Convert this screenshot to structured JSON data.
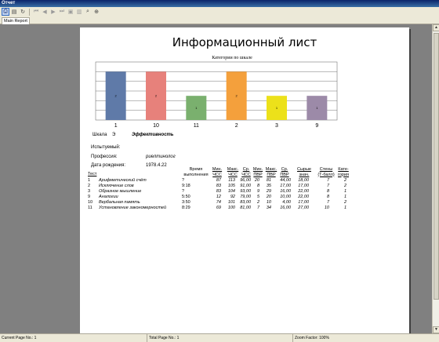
{
  "window": {
    "title": "Отчет"
  },
  "toolbar": {
    "icons": [
      "print-icon",
      "page-setup-icon",
      "refresh-icon",
      "first-page-icon",
      "prev-page-icon",
      "next-page-icon",
      "last-page-icon",
      "export-icon",
      "save-icon",
      "find-icon",
      "zoom-icon"
    ]
  },
  "tab": {
    "label": "Main Report"
  },
  "report": {
    "title": "Информационный лист",
    "scale_label": "Шкала",
    "scale_value": "Э",
    "scale_name": "Эффективность",
    "subject_label": "Испытуемый:",
    "profession_label": "Профессия:",
    "profession_value": "риелтинолог",
    "birthdate_label": "Дата рождения:",
    "birthdate_value": "1978.4.22"
  },
  "chart_data": {
    "type": "bar",
    "title": "Категории по шкале",
    "categories": [
      "1",
      "10",
      "11",
      "2",
      "3",
      "9"
    ],
    "values": [
      2,
      2,
      1,
      2,
      1,
      1
    ],
    "colors": [
      "#5f7aa8",
      "#e7817b",
      "#7ab06e",
      "#f4a03c",
      "#ece11a",
      "#9c8aa8"
    ],
    "ylim": [
      0,
      2.4
    ],
    "grid": true
  },
  "table": {
    "headers": {
      "test": "Тест",
      "time": [
        "Время",
        "выполнения"
      ],
      "min_hr": [
        "Мин.",
        "ЧСС"
      ],
      "max_hr": [
        "Макс.",
        "ЧСС"
      ],
      "avg_hr": [
        "Ср.",
        "ЧСС"
      ],
      "min_bp": [
        "Мин.",
        "ПВР"
      ],
      "max_bp": [
        "Макс.",
        "ПВР"
      ],
      "avg_bp": [
        "Ср.",
        "ПВР"
      ],
      "raw": [
        "Сырые",
        "знач."
      ],
      "sten": [
        "Стены",
        "(Т-балл)"
      ],
      "cat": [
        "Кате-",
        "гория"
      ]
    },
    "rows": [
      {
        "num": "1",
        "name": "Арифметический счёт",
        "time": "?",
        "min_hr": "87",
        "max_hr": "113",
        "avg_hr": "96,00",
        "min_bp": "20",
        "max_bp": "81",
        "avg_bp": "44,00",
        "raw": "18,00",
        "sten": "7",
        "cat": "2"
      },
      {
        "num": "2",
        "name": "Исключение слов",
        "time": "9:18",
        "min_hr": "83",
        "max_hr": "105",
        "avg_hr": "91,00",
        "min_bp": "8",
        "max_bp": "35",
        "avg_bp": "17,00",
        "raw": "17,00",
        "sten": "7",
        "cat": "2"
      },
      {
        "num": "3",
        "name": "Образное мышление",
        "time": "?",
        "min_hr": "83",
        "max_hr": "104",
        "avg_hr": "93,00",
        "min_bp": "9",
        "max_bp": "29",
        "avg_bp": "16,00",
        "raw": "22,00",
        "sten": "8",
        "cat": "1"
      },
      {
        "num": "9",
        "name": "Аналогии",
        "time": "5:50",
        "min_hr": "12",
        "max_hr": "92",
        "avg_hr": "79,00",
        "min_bp": "5",
        "max_bp": "20",
        "avg_bp": "10,00",
        "raw": "22,00",
        "sten": "8",
        "cat": "1"
      },
      {
        "num": "10",
        "name": "Вербальная память",
        "time": "3:50",
        "min_hr": "74",
        "max_hr": "101",
        "avg_hr": "83,00",
        "min_bp": "2",
        "max_bp": "10",
        "avg_bp": "4,00",
        "raw": "17,00",
        "sten": "7",
        "cat": "2"
      },
      {
        "num": "11",
        "name": "Установление закономерностей",
        "time": "8:29",
        "min_hr": "69",
        "max_hr": "100",
        "avg_hr": "81,00",
        "min_bp": "7",
        "max_bp": "34",
        "avg_bp": "16,00",
        "raw": "27,00",
        "sten": "10",
        "cat": "1"
      }
    ]
  },
  "status": {
    "current_page": "Current Page No.: 1",
    "total_page": "Total Page No.: 1",
    "zoom": "Zoom Factor: 100%"
  }
}
